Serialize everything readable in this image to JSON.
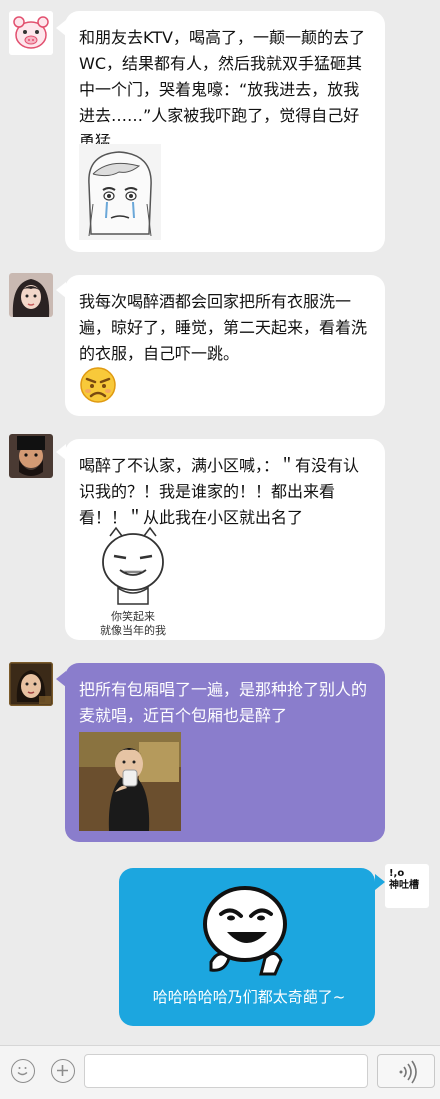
{
  "messages": [
    {
      "sender": "pig-avatar",
      "text": "和朋友去KTV，喝高了，一颠一颠的去了WC，结果都有人，然后我就双手猛砸其中一个门，哭着鬼嚎：“放我进去，放我进去……”人家被我吓跑了，觉得自己好勇猛"
    },
    {
      "sender": "girl-avatar",
      "text": "我每次喝醉酒都会回家把所有衣服洗一遍，晾好了，睡觉，第二天起来，看着洗的衣服，自己吓一跳。"
    },
    {
      "sender": "bearded-man-avatar",
      "text": "喝醉了不认家，满小区喊，：＂有没有认识我的？！我是谁家的！！都出来看看！！＂从此我在小区就出名了",
      "sticker_caption": "你笑起来\n就像当年的我"
    },
    {
      "sender": "woman-avatar",
      "text": "把所有包厢唱了一遍，是那种抢了别人的麦就唱，近百个包厢也是醉了"
    },
    {
      "sender": "me",
      "avatar_text": "!,o\n神吐槽",
      "text": "哈哈哈哈哈乃们都太奇葩了~"
    }
  ],
  "input_bar": {
    "emoji_icon": "smiley-icon",
    "plus_icon": "plus-icon",
    "voice_icon": "voice-waves-icon",
    "placeholder": ""
  },
  "colors": {
    "background": "#ebebeb",
    "bubble_white": "#ffffff",
    "bubble_purple": "#8a7dcc",
    "bubble_blue": "#1ca6df"
  }
}
